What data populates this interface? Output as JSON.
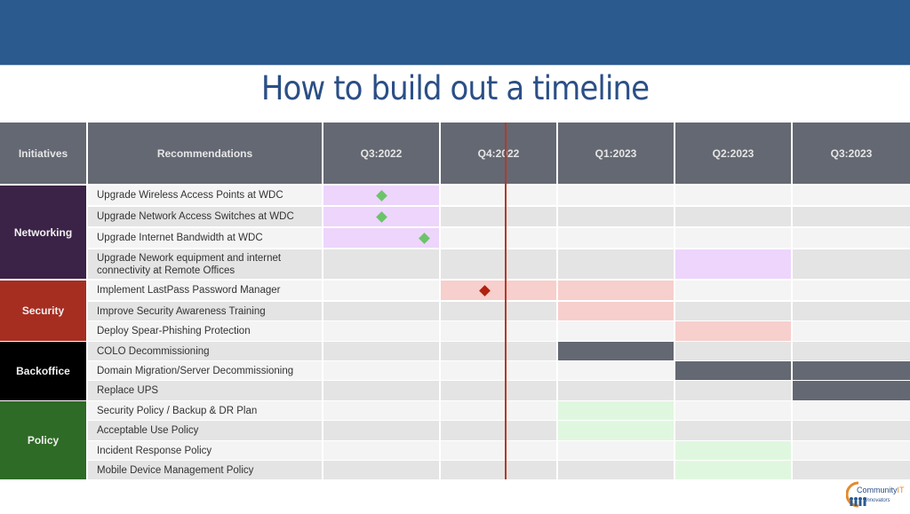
{
  "slide": {
    "title": "How to build out a timeline"
  },
  "table": {
    "headers": {
      "initiatives": "Initiatives",
      "recommendations": "Recommendations",
      "quarters": [
        "Q3:2022",
        "Q4:2022",
        "Q1:2023",
        "Q2:2023",
        "Q3:2023"
      ]
    },
    "groups": [
      {
        "name": "Networking",
        "color": "#3B2347",
        "rows": [
          0,
          1,
          2,
          3
        ]
      },
      {
        "name": "Security",
        "color": "#A62E21",
        "rows": [
          4,
          5,
          6
        ]
      },
      {
        "name": "Backoffice",
        "color": "#000000",
        "rows": [
          7,
          8,
          9
        ]
      },
      {
        "name": "Policy",
        "color": "#2E6B26",
        "rows": [
          10,
          11,
          12,
          13
        ]
      }
    ],
    "rows": [
      {
        "recommendation": "Upgrade Wireless Access Points at WDC",
        "group": "Networking",
        "bars": [
          {
            "quarter": 0,
            "color": "#EDD5FB"
          }
        ],
        "milestones": [
          {
            "quarter": 0,
            "position": 0.5,
            "color": "#6CC46A"
          }
        ]
      },
      {
        "recommendation": "Upgrade Network Access Switches at WDC",
        "group": "Networking",
        "bars": [
          {
            "quarter": 0,
            "color": "#EDD5FB"
          }
        ],
        "milestones": [
          {
            "quarter": 0,
            "position": 0.5,
            "color": "#6CC46A"
          }
        ]
      },
      {
        "recommendation": "Upgrade Internet Bandwidth at WDC",
        "group": "Networking",
        "bars": [
          {
            "quarter": 0,
            "color": "#EDD5FB"
          }
        ],
        "milestones": [
          {
            "quarter": 0,
            "position": 0.87,
            "color": "#6CC46A"
          }
        ]
      },
      {
        "recommendation": "Upgrade Nework equipment and internet connectivity at Remote Offices",
        "group": "Networking",
        "bars": [
          {
            "quarter": 3,
            "color": "#EDD5FB"
          }
        ],
        "milestones": []
      },
      {
        "recommendation": "Implement LastPass Password Manager",
        "group": "Security",
        "bars": [
          {
            "quarter": 1,
            "color": "#F7CFCC"
          },
          {
            "quarter": 2,
            "color": "#F7CFCC"
          }
        ],
        "milestones": [
          {
            "quarter": 1,
            "position": 0.38,
            "color": "#B0210F"
          }
        ]
      },
      {
        "recommendation": "Improve Security Awareness Training",
        "group": "Security",
        "bars": [
          {
            "quarter": 2,
            "color": "#F7CFCC"
          }
        ],
        "milestones": []
      },
      {
        "recommendation": "Deploy Spear-Phishing Protection",
        "group": "Security",
        "bars": [
          {
            "quarter": 3,
            "color": "#F7CFCC"
          }
        ],
        "milestones": []
      },
      {
        "recommendation": "COLO Decommissioning",
        "group": "Backoffice",
        "bars": [
          {
            "quarter": 2,
            "color": "#646872"
          }
        ],
        "milestones": []
      },
      {
        "recommendation": "Domain Migration/Server Decommissioning",
        "group": "Backoffice",
        "bars": [
          {
            "quarter": 3,
            "color": "#646872"
          },
          {
            "quarter": 4,
            "color": "#646872"
          }
        ],
        "milestones": []
      },
      {
        "recommendation": "Replace UPS",
        "group": "Backoffice",
        "bars": [
          {
            "quarter": 4,
            "color": "#646872"
          }
        ],
        "milestones": []
      },
      {
        "recommendation": "Security Policy / Backup & DR Plan",
        "group": "Policy",
        "bars": [
          {
            "quarter": 2,
            "color": "#E0F7DF"
          }
        ],
        "milestones": []
      },
      {
        "recommendation": "Acceptable Use Policy",
        "group": "Policy",
        "bars": [
          {
            "quarter": 2,
            "color": "#E0F7DF"
          }
        ],
        "milestones": []
      },
      {
        "recommendation": "Incident Response Policy",
        "group": "Policy",
        "bars": [
          {
            "quarter": 3,
            "color": "#E0F7DF"
          }
        ],
        "milestones": []
      },
      {
        "recommendation": "Mobile Device Management Policy",
        "group": "Policy",
        "bars": [
          {
            "quarter": 3,
            "color": "#E0F7DF"
          }
        ],
        "milestones": []
      }
    ],
    "today_marker": {
      "quarter": 1,
      "position": 0.56,
      "color": "#B23A2A"
    }
  },
  "logo": {
    "name": "Community IT Innovators",
    "line1": "Community",
    "line1_accent": "IT",
    "line2": "innovators"
  },
  "colors": {
    "top_band": "#2B5A8F",
    "title": "#2B4F86",
    "header_bg": "#646872",
    "row_light": "#F4F4F4",
    "row_dark": "#E4E4E4"
  }
}
